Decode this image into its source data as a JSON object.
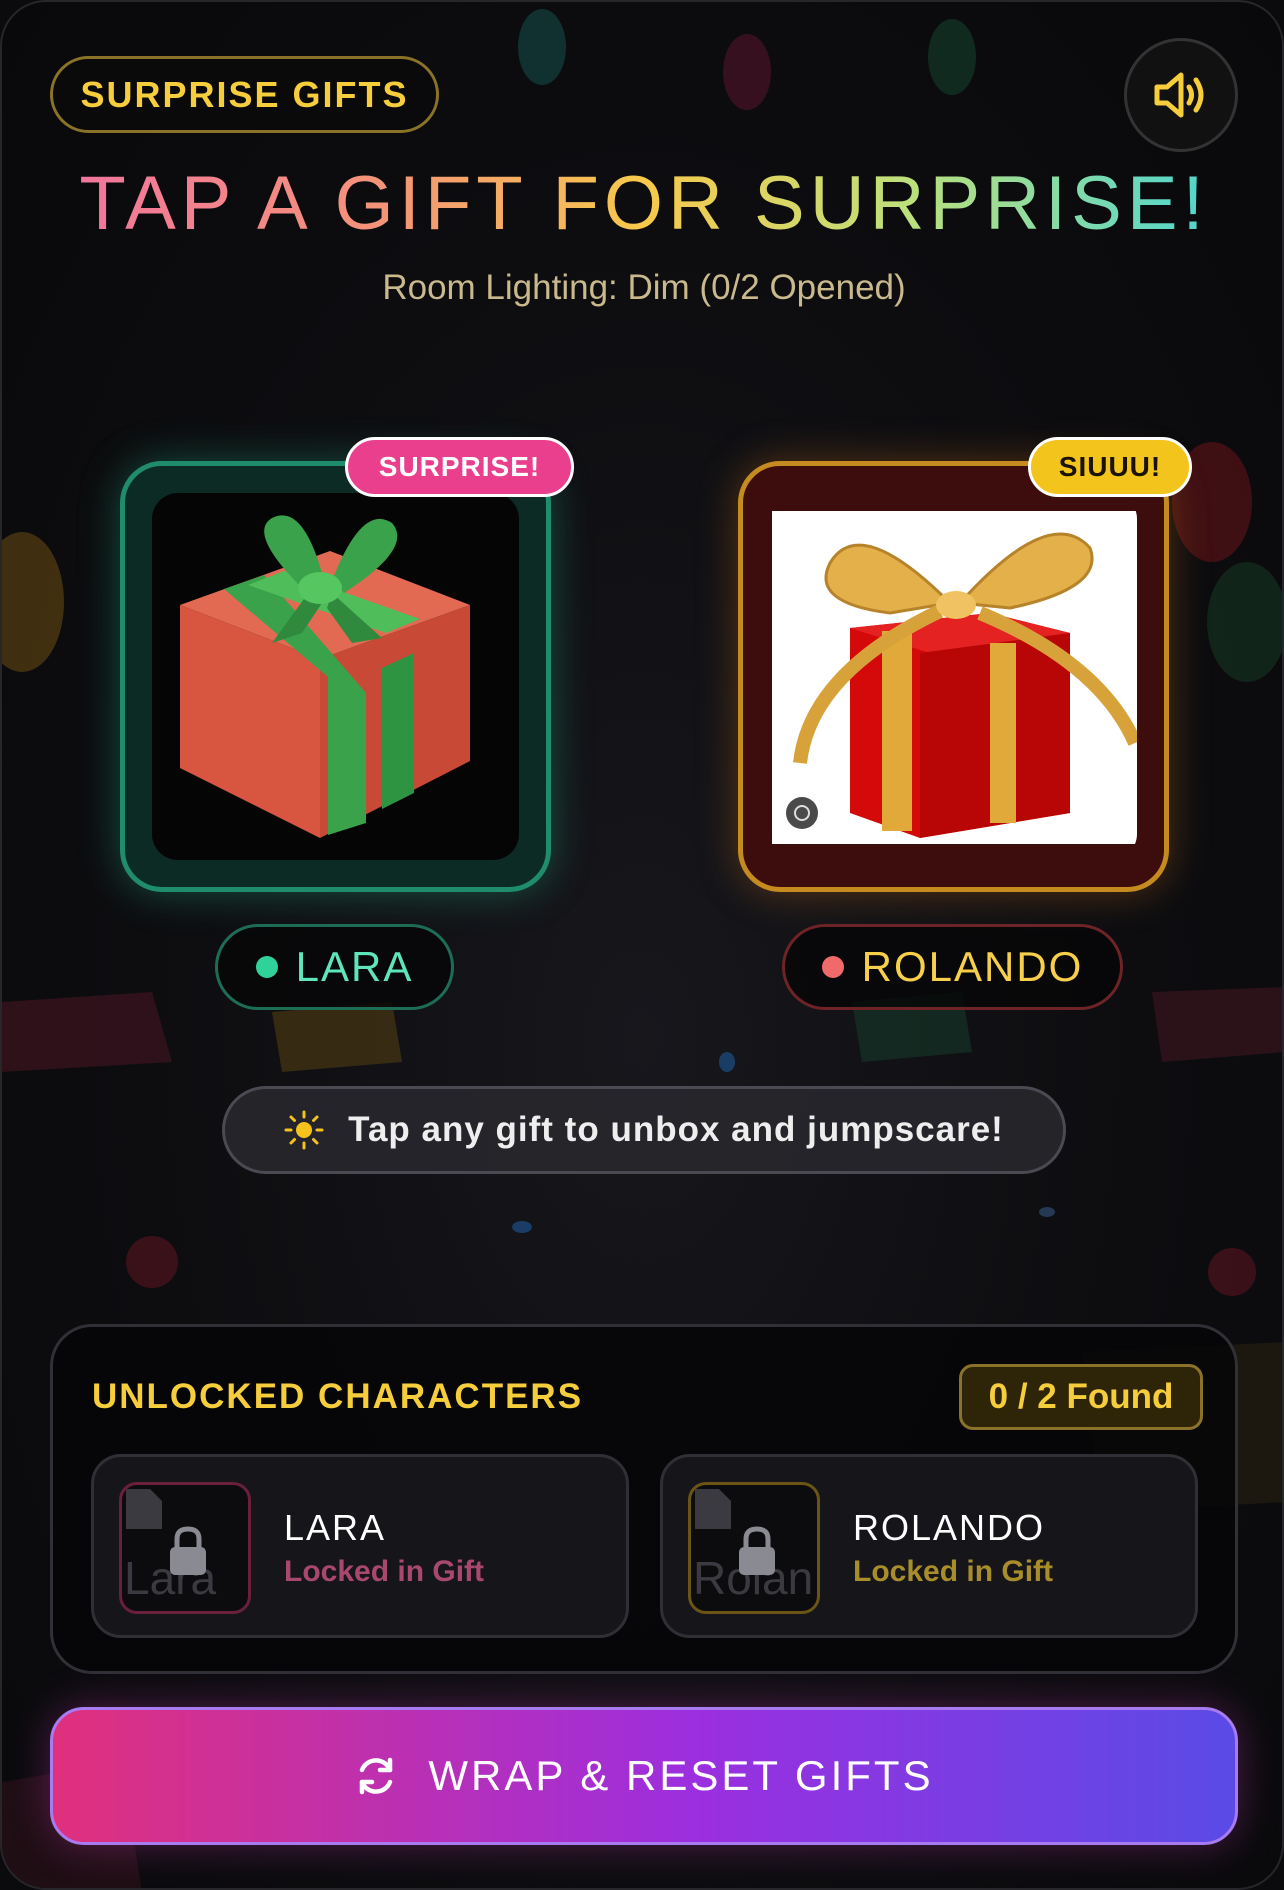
{
  "header": {
    "brand_label": "SURPRISE GIFTS",
    "sound_icon": "speaker-volume-icon",
    "title": "TAP A GIFT FOR SURPRISE!",
    "subtitle": "Room Lighting: Dim (0/2 Opened)"
  },
  "gifts": [
    {
      "badge": "SURPRISE!",
      "name": "LARA",
      "accent": "#2fd39a",
      "badge_color": "#ea3f8d"
    },
    {
      "badge": "SIUUU!",
      "name": "ROLANDO",
      "accent": "#f06a6a",
      "badge_color": "#f3c41c"
    }
  ],
  "hint": {
    "icon": "sun-icon",
    "text": "Tap any gift to unbox and jumpscare!"
  },
  "unlocked": {
    "title": "UNLOCKED CHARACTERS",
    "count": "0 / 2 Found",
    "characters": [
      {
        "thumb_text": "Lara",
        "name": "LARA",
        "status": "Locked in Gift"
      },
      {
        "thumb_text": "Rolan",
        "name": "ROLANDO",
        "status": "Locked in Gift"
      }
    ]
  },
  "reset_button": {
    "icon": "refresh-icon",
    "label": "WRAP & RESET GIFTS"
  }
}
